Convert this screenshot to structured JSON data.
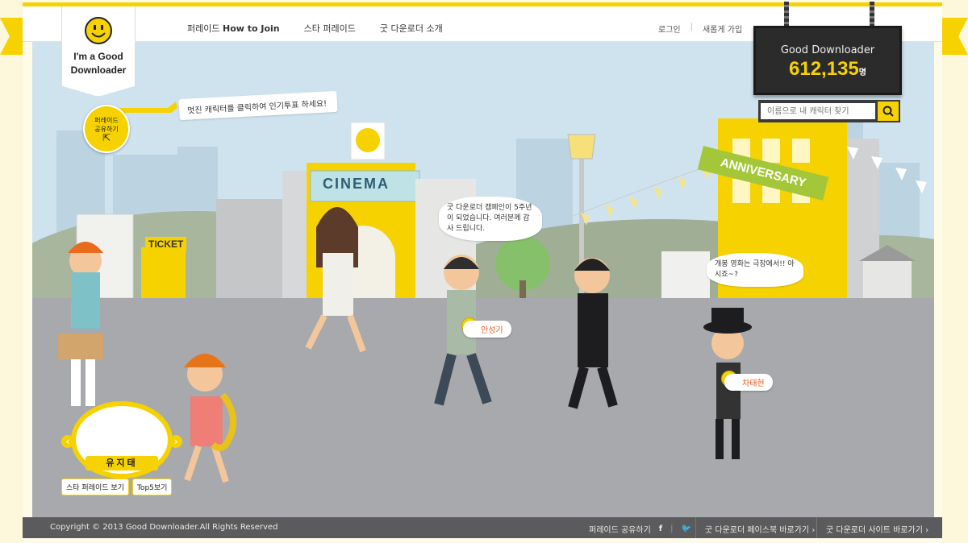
{
  "header": {
    "nav": [
      {
        "prefix": "퍼레이드 ",
        "bold": "How to Join"
      },
      {
        "label": "스타 퍼레이드"
      },
      {
        "label": "굿 다운로더 소개"
      }
    ],
    "util": {
      "login": "로그인",
      "signup": "새롭게 가입"
    }
  },
  "logo": {
    "line1": "I'm a Good",
    "line2": "Downloader"
  },
  "share": {
    "line1": "퍼레이드",
    "line2": "공유하기"
  },
  "tip": "멋진 캐릭터를 클릭하여 인기투표 하세요!",
  "counter": {
    "title": "Good Downloader",
    "value": "612,135",
    "unit": "명"
  },
  "search": {
    "placeholder": "이름으로 내 캐릭터 찾기"
  },
  "scene": {
    "cinema": "CINEMA",
    "ticket": "TICKET",
    "anniversary": "ANNIVERSARY",
    "bubble1": "굿 다운로더 캠페인이 5주년이 되었습니다. 여러분께 감사 드립니다.",
    "bubble2": "개봉 영화는 극장에서!! 아시죠~?",
    "tag1": "안성기",
    "tag2": "차태현"
  },
  "featured": {
    "name": "유지태",
    "btn1": "스타 퍼레이드 보기",
    "btn2": "Top5보기"
  },
  "footer": {
    "copyright": "Copyright © 2013 Good Downloader.All Rights Reserved",
    "share": "퍼레이드 공유하기",
    "facebook": "굿 다운로더 페이스북 바로가기 ›",
    "site": "굿 다운로더 사이트 바로가기 ›"
  },
  "colors": {
    "brand": "#f6d200",
    "footer": "#5b5b5d",
    "sky": "#cfe3ef",
    "ground": "#a7a9ad"
  }
}
